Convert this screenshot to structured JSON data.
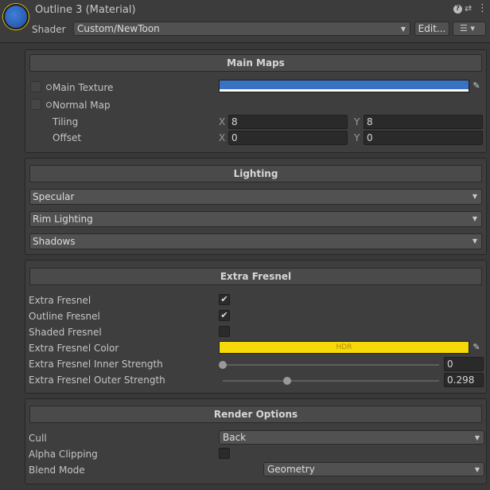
{
  "header": {
    "title": "Outline 3 (Material)",
    "shader_label": "Shader",
    "shader_value": "Custom/NewToon",
    "edit_label": "Edit...",
    "help_glyph": "?",
    "preset_glyph": "⇄",
    "more_glyph": "⋮",
    "list_glyph": "☰ ▾"
  },
  "main_maps": {
    "title": "Main Maps",
    "main_texture_label": "Main Texture",
    "main_texture_color": "#3a72c2",
    "normal_map_label": "Normal Map",
    "tiling_label": "Tiling",
    "offset_label": "Offset",
    "x_label": "X",
    "y_label": "Y",
    "tiling_x": "8",
    "tiling_y": "8",
    "offset_x": "0",
    "offset_y": "0"
  },
  "lighting": {
    "title": "Lighting",
    "foldouts": [
      "Specular",
      "Rim Lighting",
      "Shadows"
    ]
  },
  "extra_fresnel": {
    "title": "Extra Fresnel",
    "extra_fresnel_label": "Extra Fresnel",
    "extra_fresnel_checked": true,
    "outline_fresnel_label": "Outline Fresnel",
    "outline_fresnel_checked": true,
    "shaded_fresnel_label": "Shaded Fresnel",
    "shaded_fresnel_checked": false,
    "color_label": "Extra Fresnel Color",
    "color_value": "#f7d808",
    "color_tag": "HDR",
    "inner_label": "Extra Fresnel Inner Strength",
    "inner_value": "0",
    "inner_fraction": 0.0,
    "outer_label": "Extra Fresnel Outer Strength",
    "outer_value": "0.298",
    "outer_fraction": 0.298
  },
  "render_options": {
    "title": "Render Options",
    "cull_label": "Cull",
    "cull_value": "Back",
    "alpha_clipping_label": "Alpha Clipping",
    "alpha_clipping_checked": false,
    "blend_label": "Blend Mode",
    "blend_value": "Geometry"
  },
  "icons": {
    "material": "material-sphere-icon",
    "picker": "eyedropper-icon",
    "check": "✔",
    "dropdown": "▼"
  }
}
